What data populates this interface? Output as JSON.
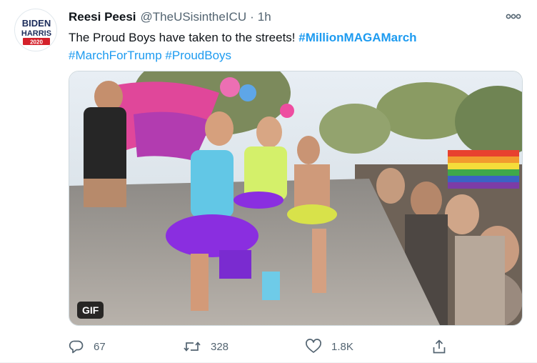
{
  "tweet": {
    "author": {
      "name": "Reesi Peesi",
      "handle": "@TheUSisintheICU",
      "separator": "·",
      "time": "1h",
      "avatar_logo": {
        "line1": "BIDEN",
        "line2": "HARRIS",
        "line3": "2020"
      }
    },
    "text": {
      "body": "The Proud Boys have taken to the streets! ",
      "hashtag1": "#MillionMAGAMarch",
      "hashtag2": "#MarchForTrump",
      "hashtag3": "#ProudBoys"
    },
    "media": {
      "badge": "GIF"
    },
    "actions": {
      "reply_count": "67",
      "retweet_count": "328",
      "like_count": "1.8K"
    }
  },
  "colors": {
    "link": "#1d9bf0",
    "secondary_text": "#536471",
    "logo_navy": "#1c2c5b",
    "logo_red": "#d4202a"
  },
  "icons": [
    "more-icon",
    "reply-icon",
    "retweet-icon",
    "like-icon",
    "share-icon"
  ]
}
